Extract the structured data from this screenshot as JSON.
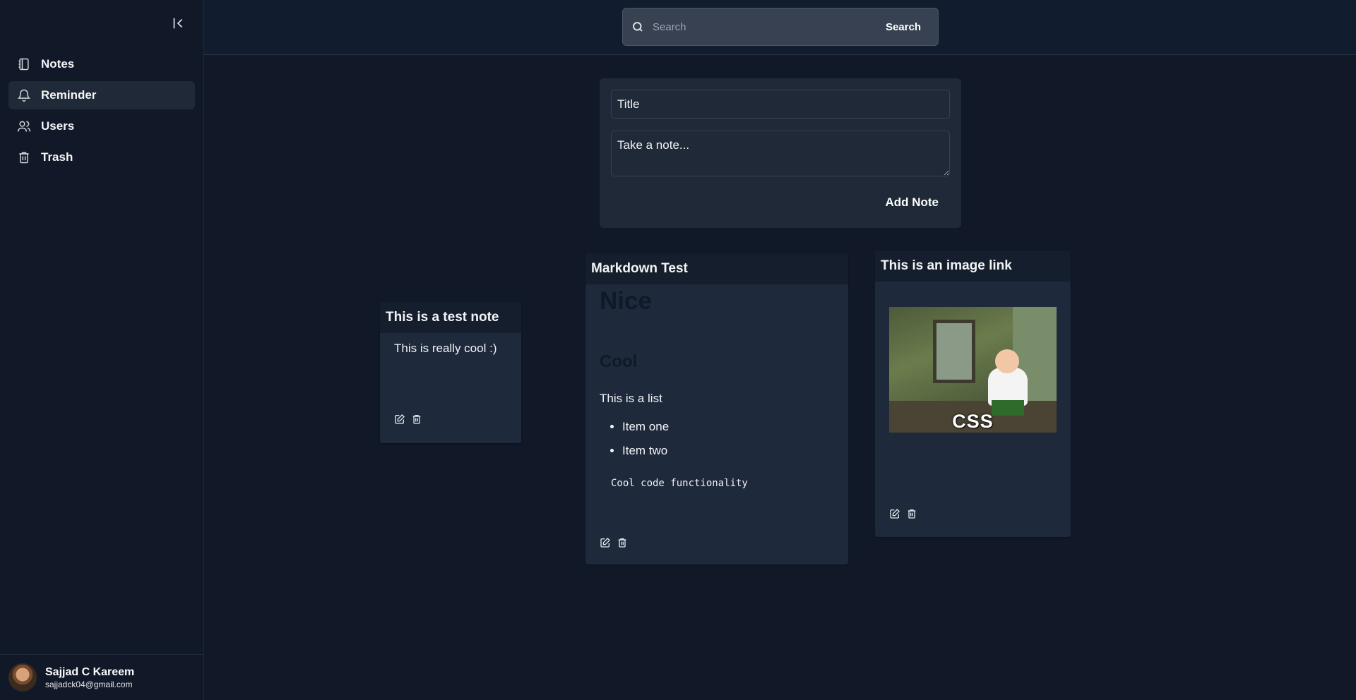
{
  "sidebar": {
    "collapse_icon": "collapse-left-icon",
    "items": [
      {
        "label": "Notes",
        "icon": "notebook-icon",
        "active": false
      },
      {
        "label": "Reminder",
        "icon": "bell-icon",
        "active": true
      },
      {
        "label": "Users",
        "icon": "users-icon",
        "active": false
      },
      {
        "label": "Trash",
        "icon": "trash-icon",
        "active": false
      }
    ],
    "user": {
      "name": "Sajjad C Kareem",
      "email": "sajjadck04@gmail.com"
    }
  },
  "search": {
    "placeholder": "Search",
    "button_label": "Search"
  },
  "composer": {
    "title_placeholder": "Title",
    "body_placeholder": "Take a note...",
    "add_label": "Add Note"
  },
  "notes": [
    {
      "title": "This is a test note",
      "body": "This is really cool :)"
    },
    {
      "title": "Markdown Test",
      "h1": "Nice",
      "h2": "Cool",
      "paragraph": "This is a list",
      "list": [
        "Item one",
        "Item two"
      ],
      "code": "Cool code functionality"
    },
    {
      "title": "This is an image link",
      "image_caption": "CSS"
    }
  ],
  "colors": {
    "background": "#111827",
    "panel": "#1f2937",
    "card": "#1e293b",
    "card_header": "#151e2c"
  }
}
